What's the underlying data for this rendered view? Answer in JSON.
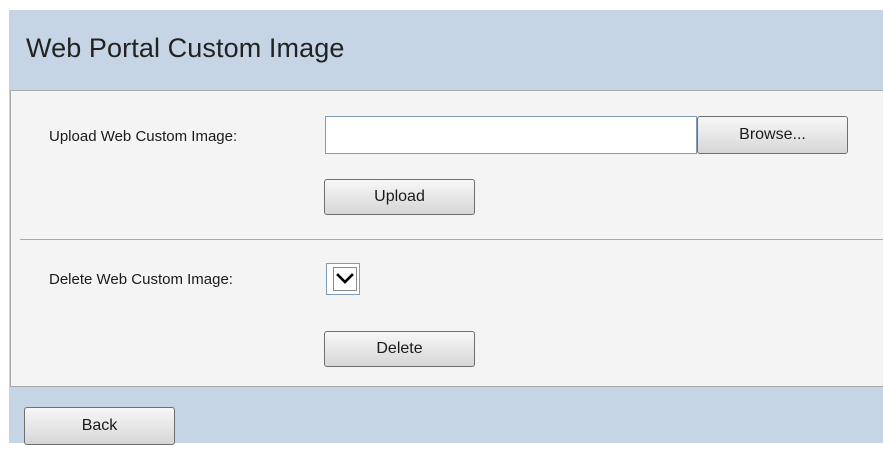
{
  "page": {
    "title": "Web Portal Custom Image"
  },
  "upload": {
    "label": "Upload Web Custom Image:",
    "file_value": "",
    "browse_label": "Browse...",
    "upload_label": "Upload"
  },
  "delete": {
    "label": "Delete Web Custom Image:",
    "selected_value": "",
    "delete_label": "Delete"
  },
  "footer": {
    "back_label": "Back"
  },
  "colors": {
    "frame_background": "#c5d5e6",
    "panel_background": "#f4f4f4",
    "panel_border": "#a9a9a9"
  },
  "icons": {
    "select_arrow": "chevron-down-icon"
  }
}
